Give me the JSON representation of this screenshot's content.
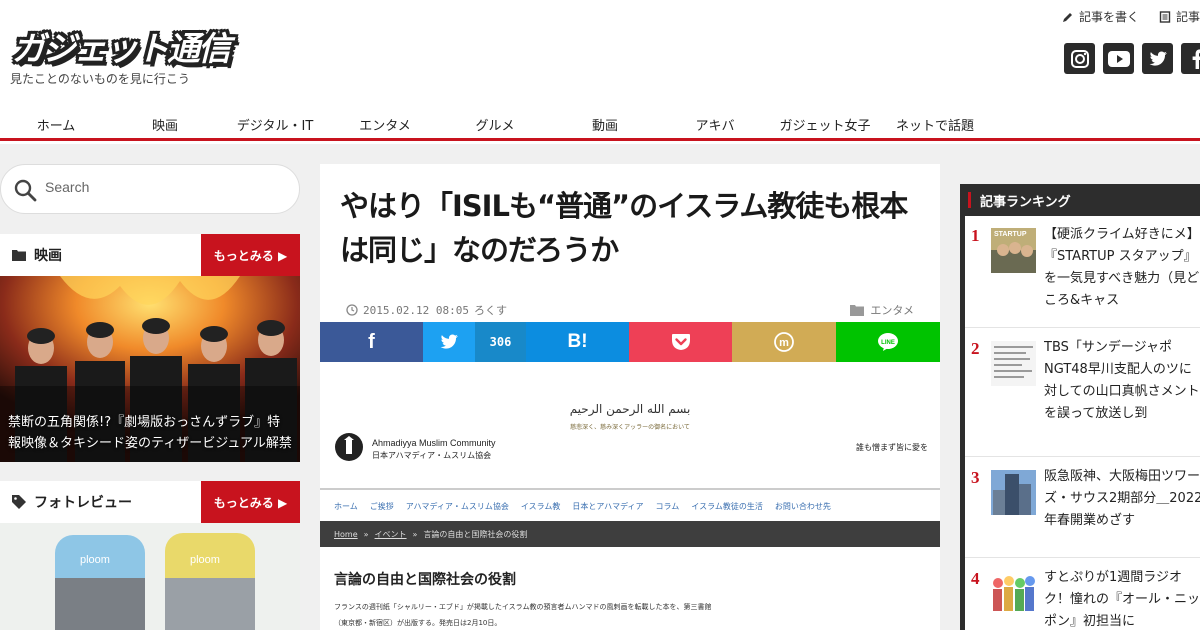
{
  "site": {
    "logo": "ガジェット通信",
    "tagline": "見たことのないものを見に行こう"
  },
  "toplinks": [
    {
      "label": "記事を書く",
      "icon": "pencil-icon"
    },
    {
      "label": "記事",
      "icon": "document-icon"
    }
  ],
  "social": [
    "instagram-icon",
    "youtube-icon",
    "twitter-icon",
    "facebook-icon"
  ],
  "nav": [
    {
      "label": "ホーム"
    },
    {
      "label": "映画"
    },
    {
      "label": "デジタル・IT"
    },
    {
      "label": "エンタメ"
    },
    {
      "label": "グルメ"
    },
    {
      "label": "動画"
    },
    {
      "label": "アキバ"
    },
    {
      "label": "ガジェット女子"
    },
    {
      "label": "ネットで話題"
    }
  ],
  "search": {
    "placeholder": "Search"
  },
  "sections": [
    {
      "title": "映画",
      "more": "もっとみる ▶",
      "caption": "禁断の五角関係!?『劇場版おっさんずラブ』特報映像＆タキシード姿のティザービジュアル解禁"
    },
    {
      "title": "フォトレビュー",
      "more": "もっとみる ▶"
    }
  ],
  "article": {
    "title": "やはり「ISILも“普通”のイスラム教徒も根本は同じ」なのだろうか",
    "date": "2015.02.12 08:05",
    "author": "ろくす",
    "category": "エンタメ",
    "share": {
      "facebook": "f",
      "twitter_count": "306",
      "hatena": "B!",
      "colors": {
        "facebook": "#3b5998",
        "twitter": "#1da1f2",
        "twitter_count_bg": "#1889c9",
        "hatena": "#0c8de0",
        "pocket": "#ee4056",
        "mixi": "#d1ab55",
        "line": "#00c300"
      }
    }
  },
  "embedded": {
    "arabic": "بسم الله الرحمن الرحيم",
    "subtitle": "慈悲深く、慈み深くアッラーの御名において",
    "org_en": "Ahmadiyya Muslim Community",
    "org_ja": "日本アハマディア・ムスリム協会",
    "right_text": "誰も憎まず皆に愛を",
    "nav": [
      "ホーム",
      "ご挨拶",
      "アハマディア・ムスリム協会",
      "イスラム教",
      "日本とアハマディア",
      "コラム",
      "イスラム教徒の生活",
      "お問い合わせ先"
    ],
    "breadcrumb": [
      "Home",
      "イベント",
      "言論の自由と国際社会の役割"
    ],
    "heading": "言論の自由と国際社会の役割",
    "body1": "フランスの週刊紙「シャルリー・エブド」が掲載したイスラム教の預言者ムハンマドの風刺画を転載した本を、第三書館",
    "body2": "（東京都・新宿区）が出版する。発売日は2月10日。"
  },
  "ranking": {
    "title": "記事ランキング",
    "items": [
      {
        "num": "1",
        "title": "【硬派クライム好きにメ】『STARTUP スタアップ』を一気見すべき魅力（見どころ&キャス"
      },
      {
        "num": "2",
        "title": "TBS「サンデージャポNGT48早川支配人のツに対しての山口真帆さメントを誤って放送し到"
      },
      {
        "num": "3",
        "title": "阪急阪神、大阪梅田ツワーズ・サウス2期部分＿2022年春開業めざす"
      },
      {
        "num": "4",
        "title": "すとぷりが1週間ラジオク！憧れの『オール・ニッポン』初担当に"
      }
    ]
  }
}
